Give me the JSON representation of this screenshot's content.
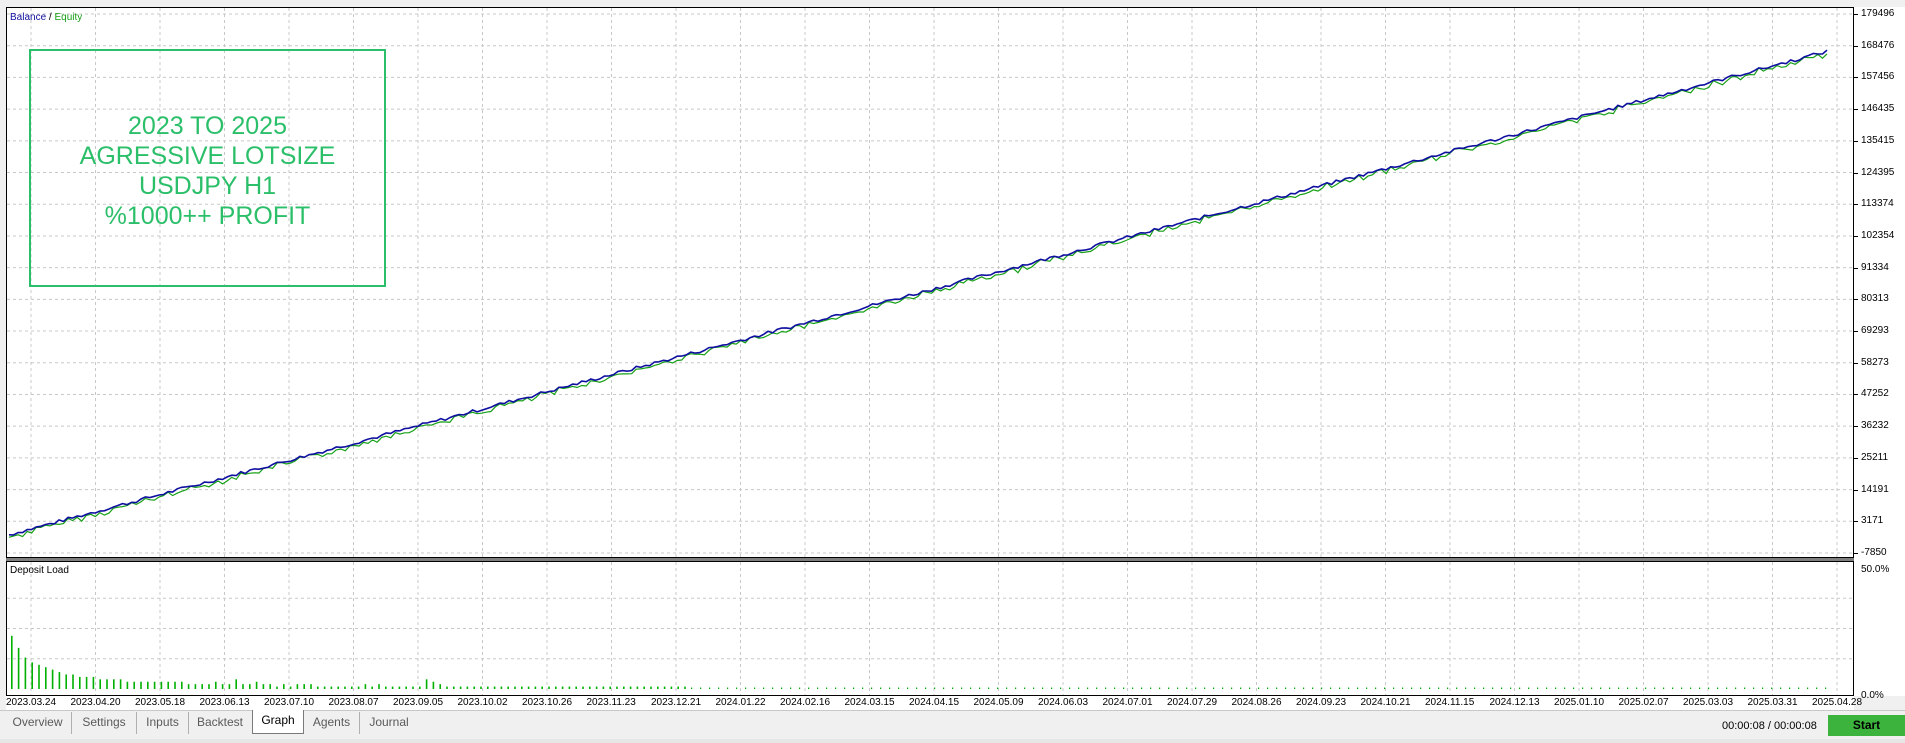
{
  "legend": {
    "balance": "Balance",
    "separator": " / ",
    "equity": "Equity"
  },
  "annotation": {
    "lines": [
      "2023 TO 2025",
      "AGRESSIVE LOTSIZE",
      "USDJPY H1",
      "%1000++ PROFIT"
    ],
    "color": "#2bbf6a"
  },
  "deposit_title": "Deposit Load",
  "colors": {
    "balance": "#1010a0",
    "equity": "#16a016",
    "deposit_bar": "#00b000",
    "grid": "#c8c8c8",
    "start_button": "#3cb33c"
  },
  "chart_data": [
    {
      "type": "line",
      "series": [
        {
          "name": "Balance",
          "values": [
            0,
            175000
          ]
        },
        {
          "name": "Equity",
          "values": [
            0,
            175000
          ]
        }
      ],
      "y_ticks": [
        "179496",
        "168476",
        "157456",
        "146435",
        "135415",
        "124395",
        "113374",
        "102354",
        "91334",
        "80313",
        "69293",
        "58273",
        "47252",
        "36232",
        "25211",
        "14191",
        "3171",
        "-7850"
      ],
      "ylim": [
        -7850,
        179496
      ],
      "x_ticks": [
        "2023.03.24",
        "2023.04.20",
        "2023.05.18",
        "2023.06.13",
        "2023.07.10",
        "2023.08.07",
        "2023.09.05",
        "2023.10.02",
        "2023.10.26",
        "2023.11.23",
        "2023.12.21",
        "2024.01.22",
        "2024.02.16",
        "2024.03.15",
        "2024.04.15",
        "2024.05.09",
        "2024.06.03",
        "2024.07.01",
        "2024.07.29",
        "2024.08.26",
        "2024.09.23",
        "2024.10.21",
        "2024.11.15",
        "2024.12.13",
        "2025.01.10",
        "2025.02.07",
        "2025.03.03",
        "2025.03.31",
        "2025.04.28"
      ],
      "grid": true
    },
    {
      "type": "bar",
      "title": "Deposit Load",
      "y_ticks": [
        "50.0%",
        "0.0%"
      ],
      "ylim": [
        0,
        50
      ],
      "values": [
        22,
        17,
        13,
        11,
        10,
        9,
        8,
        7,
        6,
        6,
        5,
        5,
        5,
        4,
        4,
        4,
        4,
        3,
        3,
        3,
        3,
        3,
        3,
        3,
        3,
        3,
        2,
        2,
        2,
        2,
        3,
        2,
        2,
        4,
        2,
        2,
        3,
        2,
        2,
        1,
        2,
        1,
        2,
        2,
        2,
        1,
        1,
        1,
        1,
        1,
        1,
        1,
        2,
        1,
        2,
        1,
        1,
        1,
        1,
        1,
        1,
        4,
        3,
        2,
        1,
        1,
        1,
        1,
        1,
        1,
        1,
        1,
        1,
        1,
        1,
        1,
        1,
        1,
        1,
        1,
        1,
        1,
        1,
        1,
        1,
        1,
        1,
        1,
        1,
        1,
        1,
        1,
        1,
        1,
        1,
        1,
        1,
        1,
        1,
        1
      ]
    }
  ],
  "tabs": [
    {
      "label": "Overview",
      "active": false
    },
    {
      "label": "Settings",
      "active": false
    },
    {
      "label": "Inputs",
      "active": false
    },
    {
      "label": "Backtest",
      "active": false
    },
    {
      "label": "Graph",
      "active": true
    },
    {
      "label": "Agents",
      "active": false
    },
    {
      "label": "Journal",
      "active": false
    }
  ],
  "timer": "00:00:08 / 00:00:08",
  "start_label": "Start"
}
